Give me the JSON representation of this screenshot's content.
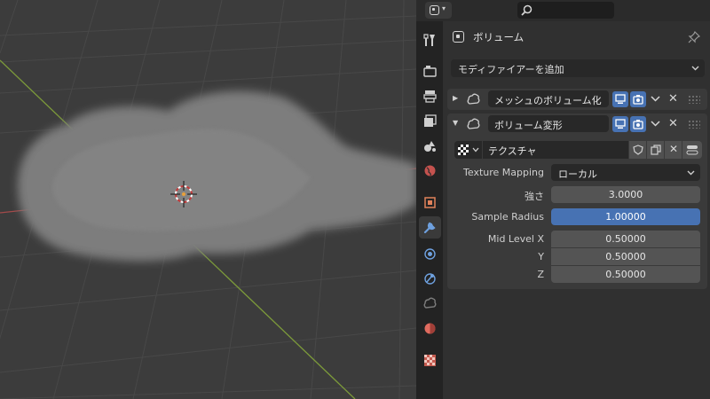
{
  "properties": {
    "context_title": "ボリューム",
    "add_modifier_label": "モディファイアーを追加",
    "modifiers": [
      {
        "name": "メッシュのボリューム化",
        "expanded": false
      },
      {
        "name": "ボリューム変形",
        "expanded": true,
        "texture_name": "テクスチャ",
        "fields": {
          "texture_mapping_label": "Texture Mapping",
          "texture_mapping_value": "ローカル",
          "strength_label": "強さ",
          "strength_value": "3.0000",
          "sample_radius_label": "Sample Radius",
          "sample_radius_value": "1.00000",
          "mid_level_x_label": "Mid Level X",
          "mid_level_x_value": "0.50000",
          "mid_level_y_label": "Y",
          "mid_level_y_value": "0.50000",
          "mid_level_z_label": "Z",
          "mid_level_z_value": "0.50000"
        }
      }
    ],
    "tabs": [
      "tool-icon",
      "render-icon",
      "output-icon",
      "view-layer-icon",
      "scene-icon",
      "world-icon",
      "object-icon",
      "modifier-icon",
      "particles-icon",
      "physics-icon",
      "constraints-icon",
      "data-icon",
      "shading-icon",
      "texture-icon"
    ],
    "active_tab": "modifier-icon"
  },
  "colors": {
    "active_field": "#4772b3",
    "x_axis": "#a34a4a",
    "y_axis": "#7c9a3a",
    "panel_bg": "#303030",
    "viewport_bg": "#3c3c3c"
  }
}
